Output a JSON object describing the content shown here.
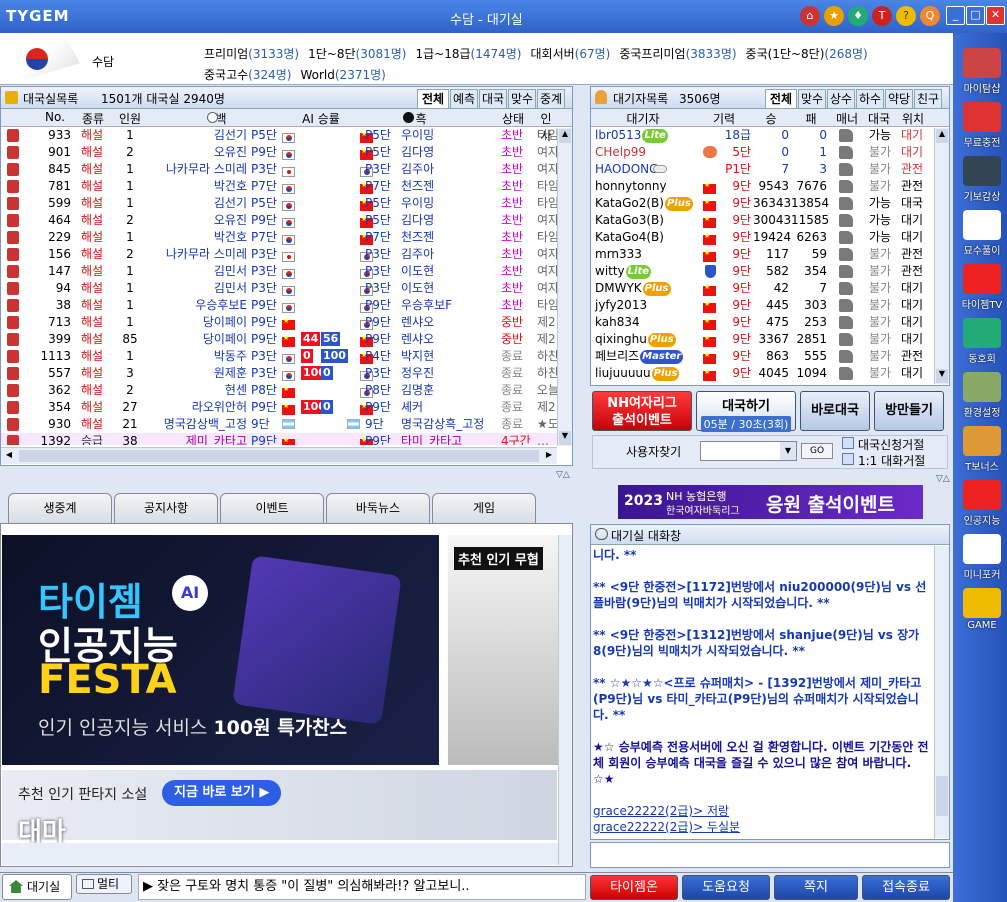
{
  "app": {
    "logo": "TYGEM",
    "title": "수담 - 대기실",
    "server_name": "수담"
  },
  "servers": {
    "line1": [
      {
        "label": "프리미엄",
        "count": "(3133명)"
      },
      {
        "label": "1단~8단",
        "count": "(3081명)"
      },
      {
        "label": "1급~18급",
        "count": "(1474명)"
      },
      {
        "label": "대회서버",
        "count": "(67명)"
      },
      {
        "label": "중국프리미엄",
        "count": "(3833명)"
      },
      {
        "label": "중국(1단~8단)",
        "count": "(268명)"
      }
    ],
    "line2": [
      {
        "label": "중국고수",
        "count": "(324명)"
      },
      {
        "label": "World",
        "count": "(2371명)"
      }
    ]
  },
  "rooms": {
    "title": "대국실목록",
    "summary": "1501개 대국실  2940명",
    "tabs": [
      "전체",
      "예측",
      "대국",
      "맞수",
      "중계"
    ],
    "columns": [
      "No.",
      "종류",
      "인원",
      "백",
      "AI 승률",
      "흑",
      "상태",
      "인사"
    ],
    "rows": [
      [
        "933",
        "해설",
        "1",
        "김선기",
        "P5단",
        "kr",
        "",
        "",
        "cn",
        "P5단",
        "우이밍",
        "초반",
        "타임"
      ],
      [
        "901",
        "해설",
        "2",
        "오유진",
        "P9단",
        "kr",
        "",
        "",
        "cn",
        "P5단",
        "김다영",
        "초반",
        "여자"
      ],
      [
        "845",
        "해설",
        "1",
        "나카무라 스미레",
        "P3단",
        "jp",
        "",
        "",
        "kr",
        "P3단",
        "김주아",
        "초반",
        "여자"
      ],
      [
        "781",
        "해설",
        "1",
        "박건호",
        "P7단",
        "kr",
        "",
        "",
        "cn",
        "P7단",
        "천즈젠",
        "초반",
        "타임"
      ],
      [
        "599",
        "해설",
        "1",
        "김선기",
        "P5단",
        "kr",
        "",
        "",
        "cn",
        "P5단",
        "우이밍",
        "초반",
        "타임"
      ],
      [
        "464",
        "해설",
        "2",
        "오유진",
        "P9단",
        "kr",
        "",
        "",
        "cn",
        "P5단",
        "김다영",
        "초반",
        "여자"
      ],
      [
        "229",
        "해설",
        "1",
        "박건호",
        "P7단",
        "kr",
        "",
        "",
        "cn",
        "P7단",
        "천즈젠",
        "초반",
        "타임"
      ],
      [
        "156",
        "해설",
        "2",
        "나카무라 스미레",
        "P3단",
        "jp",
        "",
        "",
        "kr",
        "P3단",
        "김주아",
        "초반",
        "여자"
      ],
      [
        "147",
        "해설",
        "1",
        "김민서",
        "P3단",
        "kr",
        "",
        "",
        "kr",
        "P3단",
        "이도현",
        "초반",
        "여자"
      ],
      [
        "94",
        "해설",
        "1",
        "김민서",
        "P3단",
        "kr",
        "",
        "",
        "kr",
        "P3단",
        "이도현",
        "초반",
        "여자"
      ],
      [
        "38",
        "해설",
        "1",
        "우승후보E",
        "P9단",
        "kr",
        "",
        "",
        "kr",
        "P9단",
        "우승후보F",
        "초반",
        "타임"
      ],
      [
        "713",
        "해설",
        "1",
        "당이페이",
        "P9단",
        "cn",
        "",
        "",
        "kr",
        "P9단",
        "렌샤오",
        "중반",
        "제2"
      ],
      [
        "399",
        "해설",
        "85",
        "당이페이",
        "P9단",
        "cn",
        "44",
        "56",
        "cn",
        "P9단",
        "렌샤오",
        "중반",
        "제2"
      ],
      [
        "1113",
        "해설",
        "1",
        "박동주",
        "P3단",
        "kr",
        "0",
        "100",
        "cn",
        "P4단",
        "박지현",
        "종료",
        "하찬"
      ],
      [
        "557",
        "해설",
        "3",
        "원제훈",
        "P3단",
        "kr",
        "100",
        "0",
        "kr",
        "P3단",
        "정우진",
        "종료",
        "하찬"
      ],
      [
        "362",
        "해설",
        "2",
        "현센",
        "P8단",
        "cn",
        "",
        "",
        "kr",
        "P8단",
        "김명훈",
        "종료",
        "오늘"
      ],
      [
        "354",
        "해설",
        "27",
        "라오위안허",
        "P9단",
        "cn",
        "100",
        "0",
        "cn",
        "P9단",
        "셰커",
        "종료",
        "제2"
      ],
      [
        "930",
        "해설",
        "21",
        "명국감상백_고정",
        "9단",
        "ar",
        "",
        "",
        "ar",
        "9단",
        "명국감상흑_고정",
        "종료",
        "★도"
      ],
      [
        "1392",
        "승급",
        "38",
        "제미_카타고",
        "P9단",
        "cn",
        "",
        "",
        "cn",
        "P9단",
        "타미_카타고",
        "4구간",
        "…"
      ]
    ]
  },
  "waiting": {
    "title": "대기자목록",
    "summary": "3506명",
    "tabs": [
      "전체",
      "맞수",
      "상수",
      "하수",
      "약당",
      "친구"
    ],
    "columns": [
      "대기자",
      "기력",
      "승",
      "패",
      "매너",
      "대국",
      "위치"
    ],
    "rows": [
      [
        "lbr0513",
        "Lite",
        "",
        "18급",
        "0",
        "0",
        "가능",
        "대기"
      ],
      [
        "CHelp99",
        "",
        "pro",
        "5단",
        "0",
        "1",
        "불가",
        "대기"
      ],
      [
        "HAODONG",
        "",
        "cloud",
        "P1단",
        "7",
        "3",
        "불가",
        "관전"
      ],
      [
        "honnytonny",
        "",
        "cn",
        "9단",
        "9543",
        "7676",
        "불가",
        "관전"
      ],
      [
        "KataGo2(B)",
        "Plus",
        "cn",
        "9단",
        "36343",
        "13854",
        "가능",
        "대국"
      ],
      [
        "KataGo3(B)",
        "",
        "cn",
        "9단",
        "30043",
        "11585",
        "가능",
        "대기"
      ],
      [
        "KataGo4(B)",
        "",
        "cn",
        "9단",
        "19424",
        "6263",
        "가능",
        "대기"
      ],
      [
        "mrn333",
        "",
        "cn",
        "9단",
        "117",
        "59",
        "불가",
        "관전"
      ],
      [
        "witty",
        "Lite",
        "shield",
        "9단",
        "582",
        "354",
        "불가",
        "관전"
      ],
      [
        "DMWYK",
        "Plus",
        "cn",
        "9단",
        "42",
        "7",
        "불가",
        "대기"
      ],
      [
        "jyfy2013",
        "",
        "cn",
        "9단",
        "445",
        "303",
        "불가",
        "대기"
      ],
      [
        "kah834",
        "",
        "cn",
        "9단",
        "475",
        "253",
        "불가",
        "대기"
      ],
      [
        "qixinghu",
        "Plus",
        "cn",
        "9단",
        "3367",
        "2851",
        "불가",
        "대기"
      ],
      [
        "페브리즈",
        "Master",
        "cn",
        "9단",
        "863",
        "555",
        "불가",
        "관전"
      ],
      [
        "liujuuuuu",
        "Plus",
        "cn",
        "9단",
        "4045",
        "1094",
        "불가",
        "대기"
      ]
    ]
  },
  "actions": {
    "nh_line1": "NH여자리그",
    "nh_line2": "출석이벤트",
    "start_game": "대국하기",
    "start_sub": "05분 / 30초(3회)",
    "quick_game": "바로대국",
    "visit_room": "방만들기",
    "user_search": "사용자찾기",
    "go": "GO",
    "opt1": "대국신청거절",
    "opt2": "1:1 대화거절"
  },
  "banner_nh": {
    "year": "2023",
    "line1": "NH 농협은행",
    "line2": "한국여자바둑리그",
    "cta": "응원 출석이벤트"
  },
  "chat": {
    "title": "대기실 대화창",
    "messages": [
      {
        "t": "니다. **",
        "c": "blue"
      },
      {
        "t": "",
        "c": "blue"
      },
      {
        "t": "** <9단 한중전>[1172]번방에서 niu200000(9단)님 vs 선플바람(9단)님의 빅매치가 시작되었습니다. **",
        "c": "blue"
      },
      {
        "t": "",
        "c": "blue"
      },
      {
        "t": "** <9단 한중전>[1312]번방에서 shanjue(9단)님 vs 장가8(9단)님의 빅매치가 시작되었습니다. **",
        "c": "blue"
      },
      {
        "t": "",
        "c": "blue"
      },
      {
        "t": "** ☆★☆★☆<프로 슈퍼매치> - [1392]번방에서 제미_카타고(P9단)님 vs 타미_카타고(P9단)님의 슈퍼매치가 시작되었습니다. **",
        "c": "blue"
      },
      {
        "t": "",
        "c": "blue"
      },
      {
        "t": "★☆ 승부예측 전용서버에 오신 걸 환영합니다. 이벤트 기간동안 전체 회원이 승부예측 대국을 즐길 수 있으니 많은 참여 바랍니다. ☆★",
        "c": "navy"
      },
      {
        "t": "",
        "c": "blue"
      },
      {
        "t": "grace22222(2급)> 저랑",
        "c": "user"
      },
      {
        "t": "grace22222(2급)> 두실분",
        "c": "user"
      }
    ]
  },
  "bottom_tabs": [
    "생중계",
    "공지사항",
    "이벤트",
    "바둑뉴스",
    "게임"
  ],
  "promo": {
    "brand": "타이젬",
    "ai": "AI",
    "line2": "인공지능",
    "line3": "FESTA",
    "sub1": "인기 인공지능 서비스 ",
    "sub2": "100원",
    "sub3": " 특가찬스",
    "side_title": "추천 인기 무협",
    "novel": "추천 인기 판타지 소설",
    "novel_btn": "지금 바로 보기 ▶",
    "novel_big": "대마"
  },
  "footer": {
    "lobby": "대기실",
    "multi": "멀티",
    "ticker": "▶ 잦은 구토와 명치 통증 \"이 질병\" 의심해봐라!? 알고보니..",
    "b1": "타이젬온",
    "b2": "도움요청",
    "b3": "쪽지",
    "b4": "접속종료"
  },
  "sidebar": [
    "마이탐샵",
    "무료충전",
    "기보감상",
    "묘수풀이",
    "타이젬TV",
    "동호회",
    "환경설정",
    "T보너스",
    "인공지능",
    "미니포커",
    "GAME"
  ],
  "colors": {
    "title_bar": "#2f63c9",
    "nh_red": "#e0161e",
    "blue_text": "#1538b8",
    "red_text": "#d11"
  }
}
